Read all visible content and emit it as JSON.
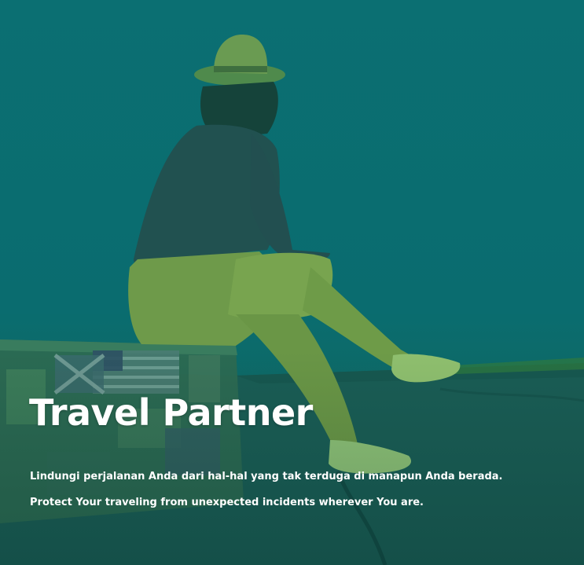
{
  "hero": {
    "title": "Travel Partner",
    "tagline_id": "Lindungi perjalanan Anda dari hal-hal yang tak terduga di manapun Anda berada.",
    "tagline_en": "Protect Your traveling from unexpected incidents wherever You are."
  },
  "image": {
    "subject": "woman-in-hat-sitting-on-suitcase",
    "tint_color": "#0b6d70",
    "ground_color": "#1a5d55"
  }
}
